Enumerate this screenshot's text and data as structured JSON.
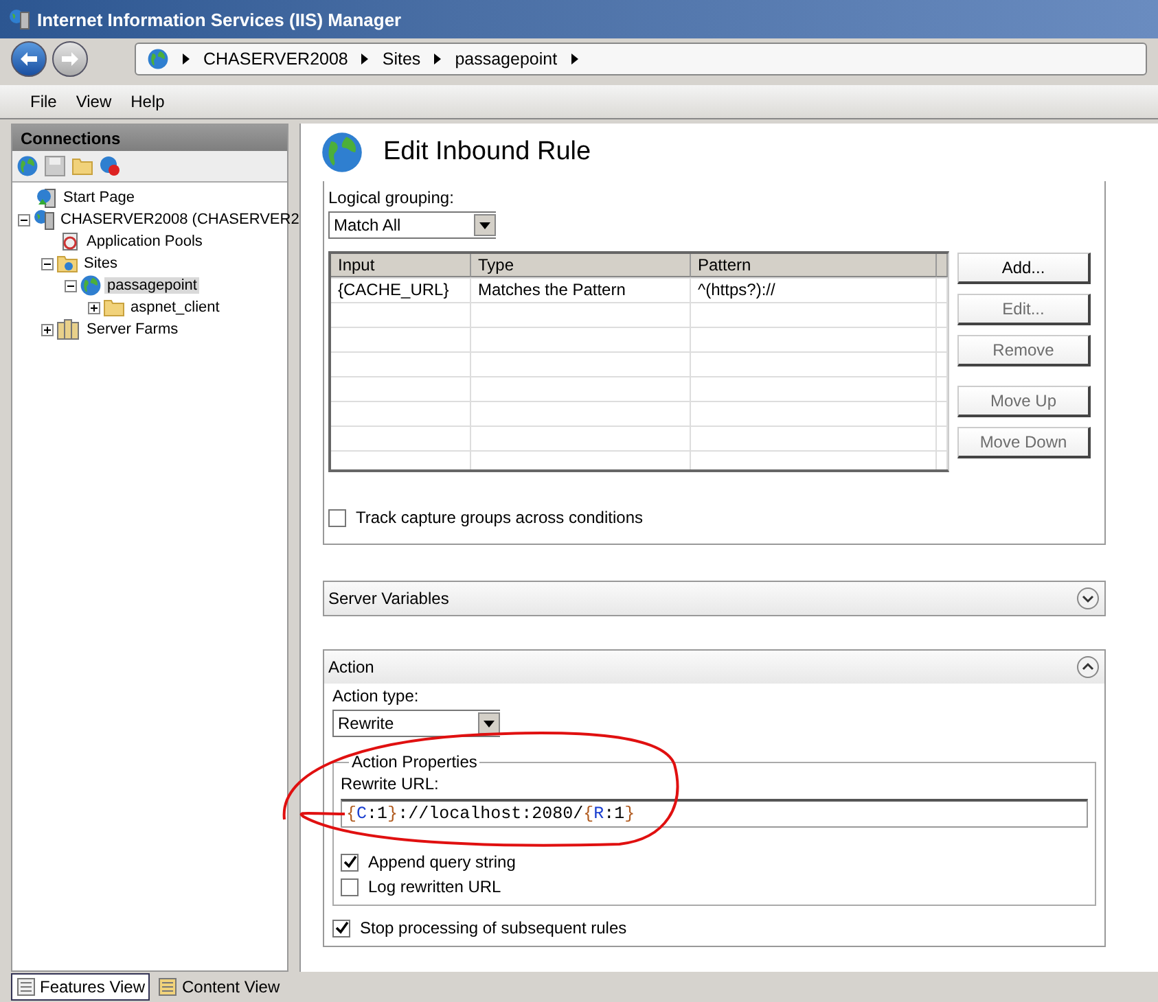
{
  "window": {
    "title": "Internet Information Services (IIS) Manager"
  },
  "address_bar": {
    "crumbs": [
      "CHASERVER2008",
      "Sites",
      "passagepoint"
    ]
  },
  "menu": [
    "File",
    "View",
    "Help"
  ],
  "connections": {
    "title": "Connections",
    "tree": [
      {
        "label": "Start Page",
        "kind": "start",
        "selected": false
      },
      {
        "label": "CHASERVER2008 (CHASERVER2",
        "kind": "server",
        "selected": false,
        "expanded": true,
        "children": [
          {
            "label": "Application Pools",
            "kind": "pool",
            "selected": false
          },
          {
            "label": "Sites",
            "kind": "sites",
            "selected": false,
            "expanded": true,
            "children": [
              {
                "label": "passagepoint",
                "kind": "site",
                "selected": true,
                "expanded": true,
                "children": [
                  {
                    "label": "aspnet_client",
                    "kind": "folder",
                    "selected": false,
                    "expanded": false
                  }
                ]
              }
            ]
          },
          {
            "label": "Server Farms",
            "kind": "farm",
            "selected": false,
            "expanded": false
          }
        ]
      }
    ]
  },
  "page": {
    "title": "Edit Inbound Rule",
    "conditions": {
      "grouping_label": "Logical grouping:",
      "grouping": "Match All",
      "columns": [
        "Input",
        "Type",
        "Pattern"
      ],
      "rows": [
        [
          "{CACHE_URL}",
          "Matches the Pattern",
          "^(https?)://"
        ]
      ],
      "buttons": [
        [
          {
            "label": "Add...",
            "disabled": false
          },
          {
            "label": "Edit...",
            "disabled": true
          },
          {
            "label": "Remove",
            "disabled": true
          }
        ],
        [
          {
            "label": "Move Up",
            "disabled": true
          },
          {
            "label": "Move Down",
            "disabled": true
          }
        ]
      ],
      "track": {
        "label": "Track capture groups across conditions",
        "checked": false
      }
    },
    "server_variables": {
      "title": "Server Variables",
      "expanded": false
    },
    "action": {
      "title": "Action",
      "expanded": true,
      "type_label": "Action type:",
      "type": "Rewrite",
      "properties_title": "Action Properties",
      "url_label": "Rewrite URL:",
      "url": [
        {
          "text": "{",
          "kind": "brace"
        },
        {
          "text": "C",
          "kind": "name"
        },
        {
          "text": ":1",
          "kind": "text"
        },
        {
          "text": "}",
          "kind": "brace"
        },
        {
          "text": "://localhost:2080/",
          "kind": "text"
        },
        {
          "text": "{",
          "kind": "brace"
        },
        {
          "text": "R",
          "kind": "name"
        },
        {
          "text": ":1",
          "kind": "text"
        },
        {
          "text": "}",
          "kind": "brace"
        }
      ],
      "options": [
        {
          "label": "Append query string",
          "checked": true
        },
        {
          "label": "Log rewritten URL",
          "checked": false
        }
      ],
      "stop": {
        "label": "Stop processing of subsequent rules",
        "checked": true
      }
    }
  },
  "views": [
    {
      "label": "Features View",
      "selected": true
    },
    {
      "label": "Content View",
      "selected": false
    }
  ]
}
